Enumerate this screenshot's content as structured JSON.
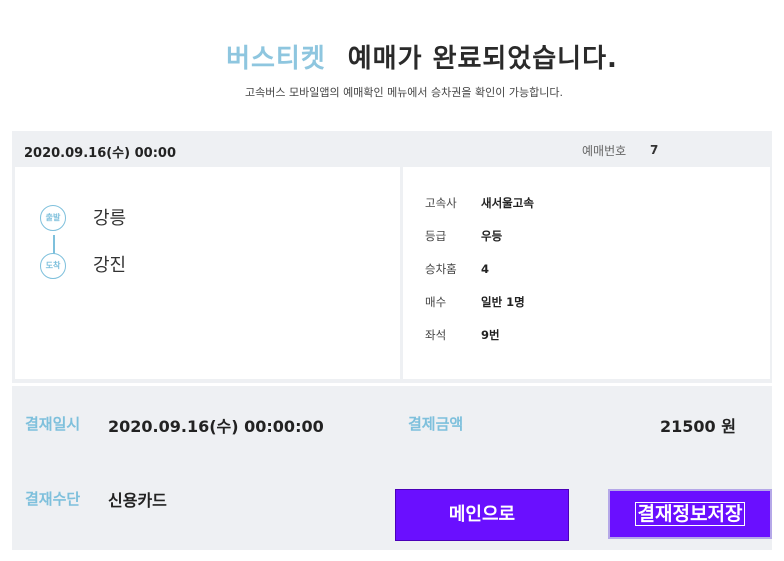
{
  "header": {
    "brand": "버스티켓",
    "title": "예매가 완료되었습니다.",
    "subtitle": "고속버스 모바일앱의 예매확인 메뉴에서 승차권을 확인이 가능합니다."
  },
  "ticket": {
    "datetime": "2020.09.16(수) 00:00",
    "reservation_label": "예매번호",
    "reservation_number": "7",
    "departure_badge": "출발",
    "departure_city": "강릉",
    "arrival_badge": "도착",
    "arrival_city": "강진",
    "details": [
      {
        "label": "고속사",
        "value": "새서울고속"
      },
      {
        "label": "등급",
        "value": "우등"
      },
      {
        "label": "승차홈",
        "value": "4"
      },
      {
        "label": "매수",
        "value": "일반 1명"
      },
      {
        "label": "좌석",
        "value": "9번"
      }
    ]
  },
  "payment": {
    "date_label": "결재일시",
    "date_value": "2020.09.16(수) 00:00:00",
    "amount_label": "결제금액",
    "amount_value": "21500 원",
    "method_label": "결재수단",
    "method_value": "신용카드"
  },
  "buttons": {
    "main": "메인으로",
    "save": "결재정보저장"
  },
  "colors": {
    "accent": "#7ec0dc",
    "button": "#6a0fff",
    "panel_bg": "#eef0f3"
  }
}
